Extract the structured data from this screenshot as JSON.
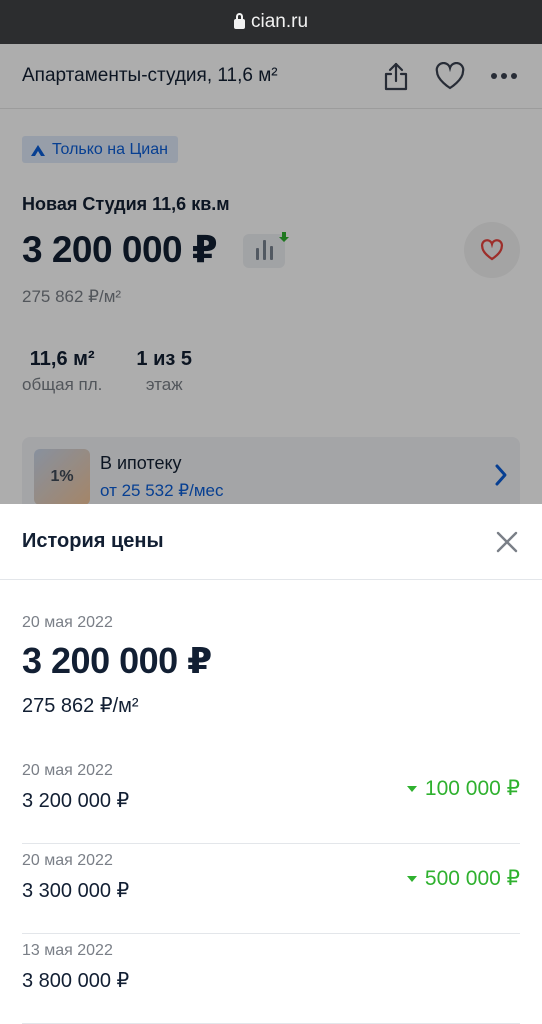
{
  "browser": {
    "url": "cian.ru"
  },
  "header": {
    "title": "Апартаменты-студия, 11,6 м²"
  },
  "listing": {
    "badge": "Только на Циан",
    "title": "Новая Студия 11,6 кв.м",
    "price": "3 200 000 ₽",
    "price_per_m": "275 862 ₽/м²",
    "facts": [
      {
        "value": "11,6 м²",
        "label": "общая пл."
      },
      {
        "value": "1 из 5",
        "label": "этаж"
      }
    ],
    "mortgage": {
      "title": "В ипотеку",
      "subtitle": "от 25 532 ₽/мес",
      "icon_text": "1%"
    }
  },
  "sheet": {
    "title": "История цены",
    "current": {
      "date": "20 мая 2022",
      "price": "3 200 000 ₽",
      "price_per_m": "275 862 ₽/м²"
    },
    "history": [
      {
        "date": "20 мая 2022",
        "price": "3 200 000 ₽",
        "change": "100 000 ₽"
      },
      {
        "date": "20 мая 2022",
        "price": "3 300 000 ₽",
        "change": "500 000 ₽"
      },
      {
        "date": "13 мая 2022",
        "price": "3 800 000 ₽",
        "change": ""
      }
    ]
  },
  "colors": {
    "accent": "#0b5ed7",
    "decrease": "#2fb12f",
    "favorite": "#e8443f"
  }
}
